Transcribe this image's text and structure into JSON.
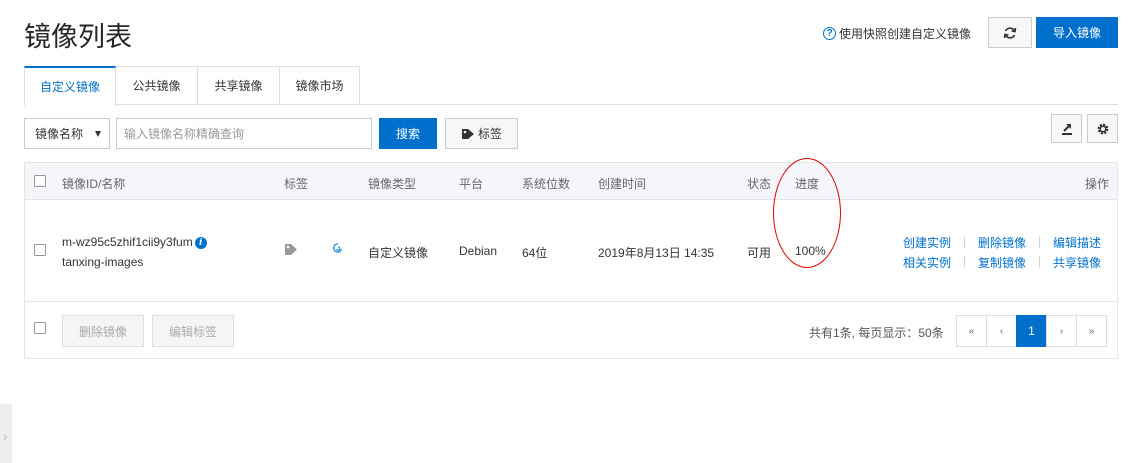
{
  "header": {
    "title": "镜像列表",
    "help_link": "使用快照创建自定义镜像",
    "import_button": "导入镜像"
  },
  "tabs": [
    {
      "label": "自定义镜像",
      "active": true
    },
    {
      "label": "公共镜像",
      "active": false
    },
    {
      "label": "共享镜像",
      "active": false
    },
    {
      "label": "镜像市场",
      "active": false
    }
  ],
  "search": {
    "select_value": "镜像名称",
    "placeholder": "输入镜像名称精确查询",
    "search_button": "搜索",
    "tag_button": "标签"
  },
  "table": {
    "columns": [
      "镜像ID/名称",
      "标签",
      "镜像类型",
      "平台",
      "系统位数",
      "创建时间",
      "状态",
      "进度",
      "操作"
    ],
    "rows": [
      {
        "id": "m-wz95c5zhif1cii9y3fum",
        "name": "tanxing-images",
        "type": "自定义镜像",
        "platform": "Debian",
        "bits": "64位",
        "created": "2019年8月13日 14:35",
        "status": "可用",
        "progress": "100%",
        "actions": [
          "创建实例",
          "删除镜像",
          "编辑描述",
          "相关实例",
          "复制镜像",
          "共享镜像"
        ]
      }
    ]
  },
  "footer": {
    "delete_button": "删除镜像",
    "edit_tag_button": "编辑标签",
    "total_text": "共有1条, 每页显示：50条",
    "pager": {
      "first": "«",
      "prev": "‹",
      "current": "1",
      "next": "›",
      "last": "»"
    }
  },
  "colors": {
    "accent": "#0070cc",
    "annotation": "#e00000"
  }
}
